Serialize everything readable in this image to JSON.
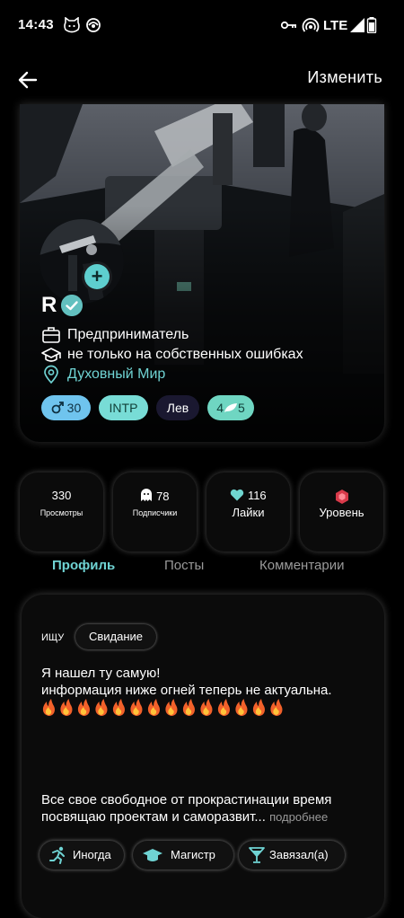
{
  "status_bar": {
    "time": "14:43",
    "network": "LTE"
  },
  "header": {
    "back_icon": "arrow-left-icon",
    "edit_label": "Изменить"
  },
  "profile": {
    "name": "R",
    "occupation": "Предприниматель",
    "education": "не только на собственных ошибках",
    "location": "Духовный Мир",
    "chips": {
      "age": "30",
      "personality": "INTP",
      "zodiac": "Лев",
      "level": "5"
    }
  },
  "stats": {
    "views": {
      "value": "330",
      "label": "Просмотры"
    },
    "followers": {
      "value": "78",
      "label": "Подписчики"
    },
    "likes": {
      "value": "116",
      "label": "Лайки"
    },
    "level": {
      "label": "Уровень"
    }
  },
  "tabs": {
    "profile": "Профиль",
    "posts": "Посты",
    "comments": "Комментарии"
  },
  "about": {
    "seeking_label": "ИЩУ",
    "seeking_value": "Свидание",
    "status_line1": "Я нашел ту самую!",
    "status_line2": "информация ниже огней теперь не актуальна.",
    "fire_count": 14,
    "bio_line1": "Все свое свободное от прокрастинации время",
    "bio_line2": "посвящаю проектам и саморазвит...",
    "more": "подробнее",
    "traits": {
      "sport": "Иногда",
      "degree": "Магистр",
      "smoking": "Завязал(а)"
    }
  },
  "colors": {
    "accent": "#6fd3d3",
    "background": "#000000",
    "card": "#0b0b0b"
  }
}
